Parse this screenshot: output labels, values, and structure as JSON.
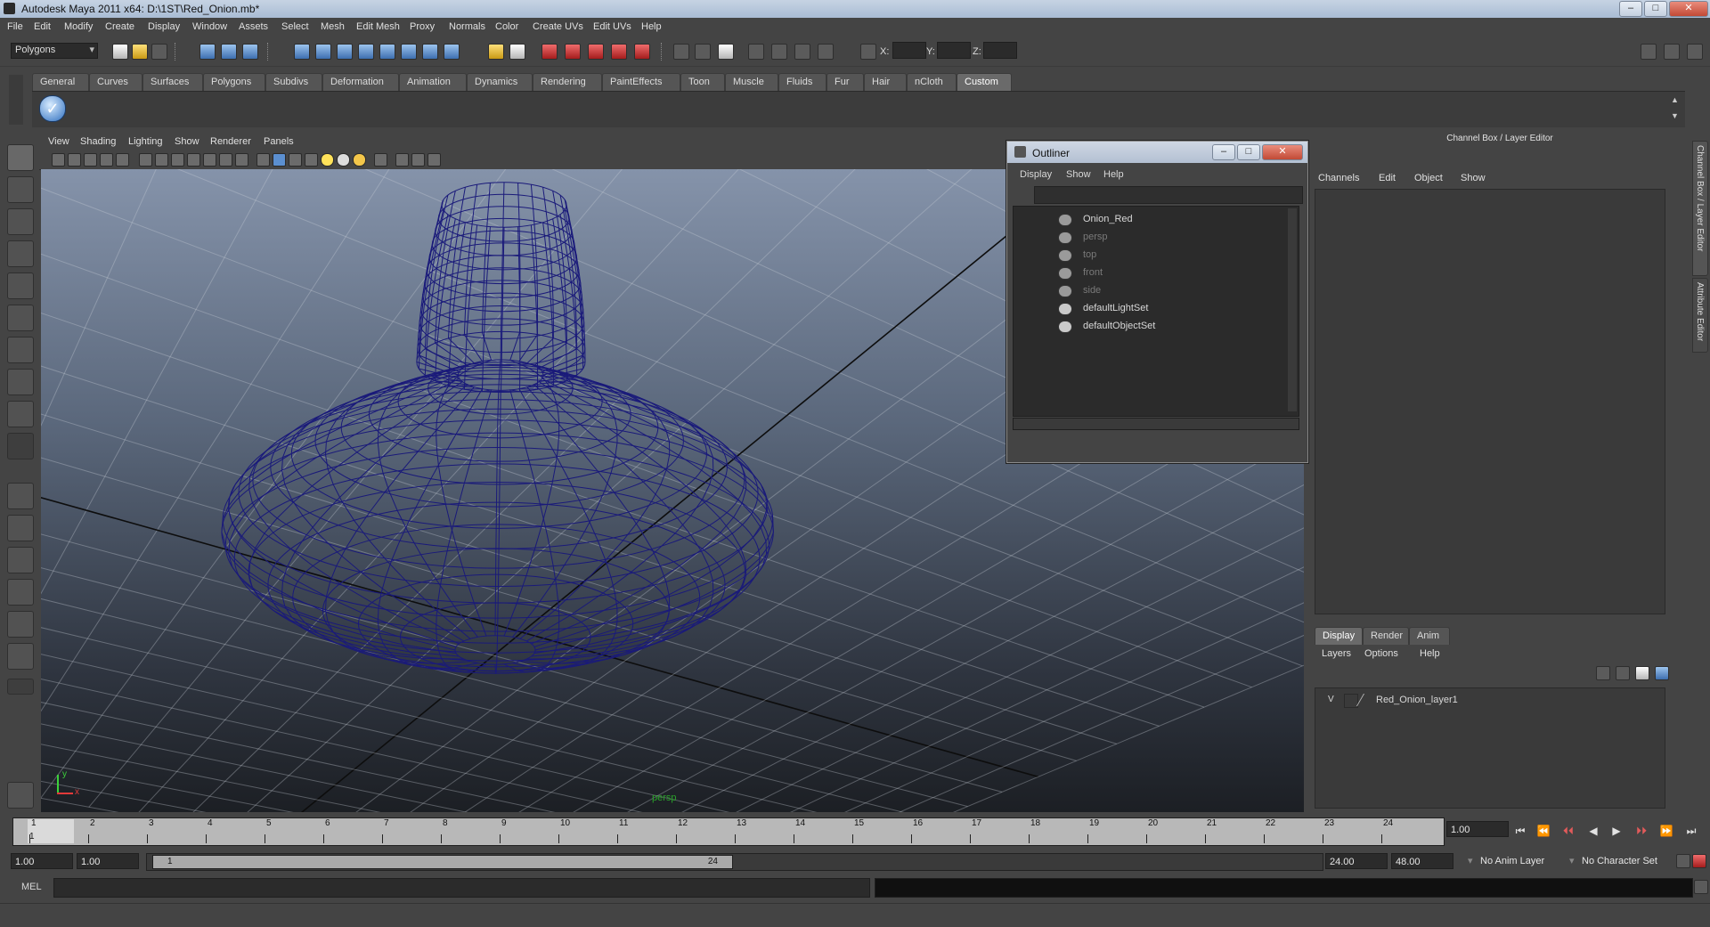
{
  "window": {
    "title": "Autodesk Maya 2011 x64: D:\\1ST\\Red_Onion.mb*",
    "min": "–",
    "max": "□",
    "close": "✕"
  },
  "menubar": [
    "File",
    "Edit",
    "Modify",
    "Create",
    "Display",
    "Window",
    "Assets",
    "Select",
    "Mesh",
    "Edit Mesh",
    "Proxy",
    "Normals",
    "Color",
    "Create UVs",
    "Edit UVs",
    "Help"
  ],
  "statusline": {
    "mode": "Polygons",
    "x_label": "X:",
    "y_label": "Y:",
    "z_label": "Z:"
  },
  "shelf": {
    "tabs": [
      "General",
      "Curves",
      "Surfaces",
      "Polygons",
      "Subdivs",
      "Deformation",
      "Animation",
      "Dynamics",
      "Rendering",
      "PaintEffects",
      "Toon",
      "Muscle",
      "Fluids",
      "Fur",
      "Hair",
      "nCloth",
      "Custom"
    ],
    "active": "Custom"
  },
  "viewport": {
    "menu": [
      "View",
      "Shading",
      "Lighting",
      "Show",
      "Renderer",
      "Panels"
    ],
    "camera_label": "persp",
    "axis_y": "y",
    "axis_x": "x",
    "wire_color": "#1a1a7a"
  },
  "outliner": {
    "title": "Outliner",
    "menu": [
      "Display",
      "Show",
      "Help"
    ],
    "items": [
      {
        "label": "Onion_Red",
        "dim": false,
        "icon": "mesh-transform-icon"
      },
      {
        "label": "persp",
        "dim": true,
        "icon": "camera-icon"
      },
      {
        "label": "top",
        "dim": true,
        "icon": "camera-icon"
      },
      {
        "label": "front",
        "dim": true,
        "icon": "camera-icon"
      },
      {
        "label": "side",
        "dim": true,
        "icon": "camera-icon"
      },
      {
        "label": "defaultLightSet",
        "dim": false,
        "icon": "set-icon"
      },
      {
        "label": "defaultObjectSet",
        "dim": false,
        "icon": "set-icon"
      }
    ]
  },
  "channelbox": {
    "header": "Channel Box / Layer Editor",
    "menu": [
      "Channels",
      "Edit",
      "Object",
      "Show"
    ],
    "side_tabs": [
      "Channel Box / Layer Editor",
      "Attribute Editor"
    ]
  },
  "layer_editor": {
    "tabs": [
      "Display",
      "Render",
      "Anim"
    ],
    "active_tab": "Display",
    "menu": [
      "Layers",
      "Options",
      "Help"
    ],
    "layers": [
      {
        "visible": "V",
        "name": "Red_Onion_layer1"
      }
    ]
  },
  "timeline": {
    "ticks": [
      "1",
      "2",
      "3",
      "4",
      "5",
      "6",
      "7",
      "8",
      "9",
      "10",
      "11",
      "12",
      "13",
      "14",
      "15",
      "16",
      "17",
      "18",
      "19",
      "20",
      "21",
      "22",
      "23",
      "24"
    ],
    "current_frame_marker": "1",
    "current_time": "1.00",
    "playback_buttons": [
      "⏮",
      "⏪",
      "⏴⏴",
      "◀",
      "▶",
      "⏵⏵",
      "⏩",
      "⏭"
    ]
  },
  "range": {
    "start_time": "1.00",
    "playback_start": "1.00",
    "range_start_label": "1",
    "range_end_label": "24",
    "playback_end": "24.00",
    "end_time": "48.00",
    "anim_layer": "No Anim Layer",
    "character_set": "No Character Set"
  },
  "command": {
    "label": "MEL"
  }
}
